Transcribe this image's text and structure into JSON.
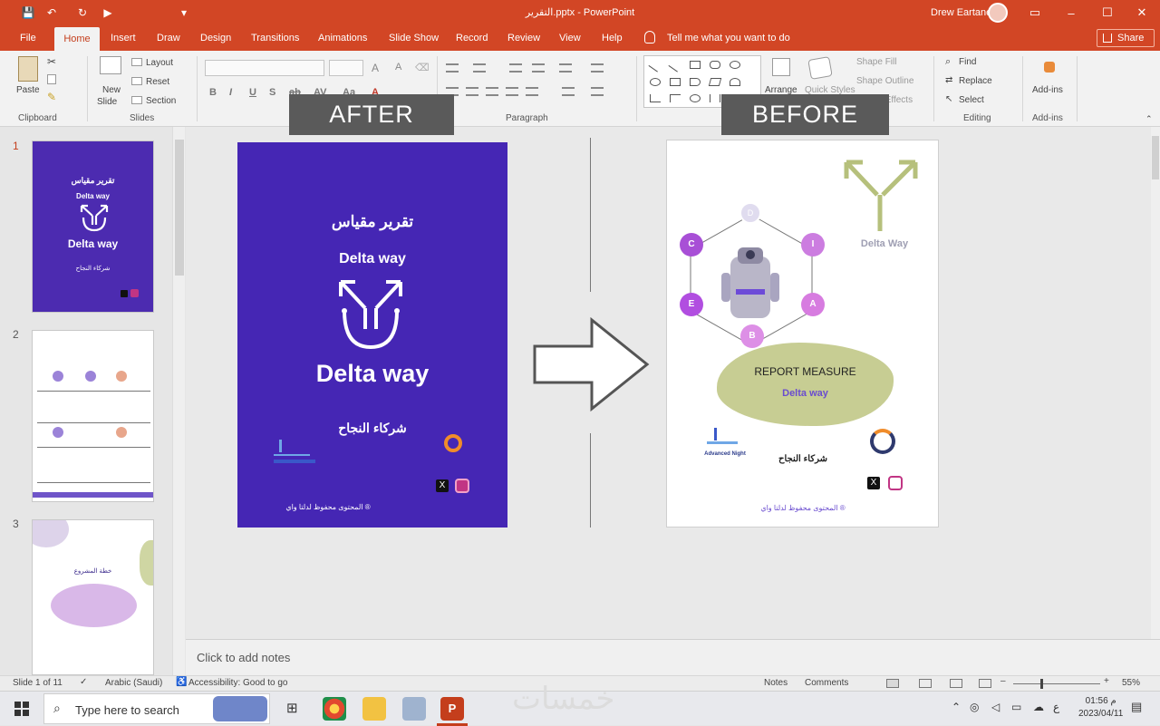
{
  "window": {
    "title": "التقرير.pptx - PowerPoint",
    "user": "Drew Eartane",
    "controls": {
      "ribbon_options": "▭",
      "minimize": "–",
      "maximize": "☐",
      "close": "✕"
    }
  },
  "quick_access": {
    "save": "💾",
    "undo": "↶",
    "redo": "↻",
    "present": "▶",
    "more": "▾"
  },
  "tabs": [
    "File",
    "Home",
    "Insert",
    "Draw",
    "Design",
    "Transitions",
    "Animations",
    "Slide Show",
    "Record",
    "Review",
    "View",
    "Help"
  ],
  "active_tab": "Home",
  "tell_me": "Tell me what you want to do",
  "share_label": "Share",
  "ribbon": {
    "clipboard": {
      "paste": "Paste",
      "group": "Clipboard"
    },
    "slides": {
      "new_slide": "New",
      "new_slide2": "Slide",
      "layout": "Layout",
      "reset": "Reset",
      "section": "Section",
      "group": "Slides"
    },
    "paragraph": {
      "group": "Paragraph"
    },
    "drawing": {
      "arrange": "Arrange",
      "quick_styles": "Quick Styles",
      "shape_fill": "Shape Fill",
      "shape_outline": "Shape Outline",
      "shape_effects": "Shape Effects"
    },
    "editing": {
      "find": "Find",
      "replace": "Replace",
      "select": "Select",
      "group": "Editing"
    },
    "addins": {
      "label": "Add-ins",
      "group": "Add-ins"
    },
    "font_fmt": {
      "b": "B",
      "i": "I",
      "u": "U",
      "s": "S",
      "abc": "ab",
      "av": "AV",
      "aa": "Aa",
      "a": "A"
    }
  },
  "thumbnails": [
    {
      "num": "1",
      "title_ar": "تقرير مقياس",
      "brand": "Delta way",
      "partner": "شركاء النجاح"
    },
    {
      "num": "2"
    },
    {
      "num": "3",
      "text_ar": "خطة المشروع"
    }
  ],
  "slide": {
    "after_label": "AFTER",
    "before_label": "BEFORE",
    "after": {
      "title_ar": "تقرير مقياس",
      "brand_small": "Delta way",
      "brand_large": "Delta way",
      "partners_ar": "شركاء النجاح",
      "footer_ar": "المحتوى محفوظ لدلتا واي ®",
      "x_label": "X"
    },
    "before": {
      "brand": "Delta Way",
      "report": "REPORT MEASURE",
      "report_sub": "Delta way",
      "partners_ar": "شركاء النجاح",
      "left_logo": "Advanced Night",
      "footer_ar": "المحتوى محفوظ لدلتا واي ®",
      "hex_letters": [
        "C",
        "I",
        "A",
        "B",
        "E",
        "D"
      ],
      "x_label": "X"
    }
  },
  "notes_placeholder": "Click to add notes",
  "status": {
    "slide_count": "Slide 1 of 11",
    "language": "Arabic (Saudi)",
    "accessibility": "Accessibility: Good to go",
    "notes": "Notes",
    "comments": "Comments",
    "zoom": "55%",
    "zoom_level": 0.55
  },
  "taskbar": {
    "search_placeholder": "Type here to search",
    "time": "01:56 م",
    "date": "2023/04/11",
    "lang": "ع",
    "watermark": "خمسات"
  },
  "colors": {
    "accent": "#d24625",
    "after_bg": "#4526b4",
    "blob": "#c7cd93",
    "hex_purple": "#a84fd6"
  }
}
